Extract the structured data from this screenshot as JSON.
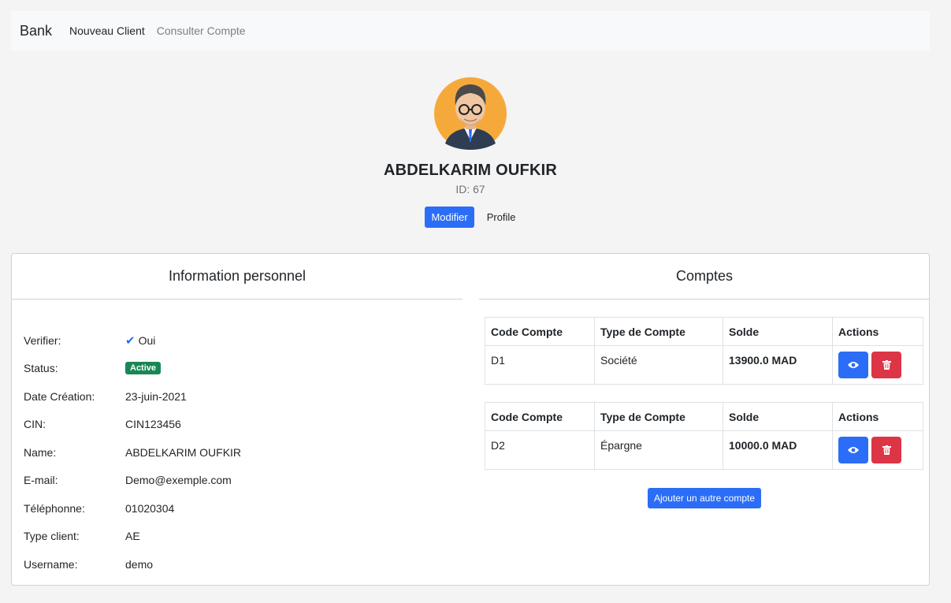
{
  "navbar": {
    "brand": "Bank",
    "links": [
      "Nouveau Client",
      "Consulter Compte"
    ]
  },
  "profile": {
    "name": "ABDELKARIM OUFKIR",
    "id": "ID: 67",
    "modify_label": "Modifier",
    "profile_label": "Profile"
  },
  "info": {
    "title": "Information personnel",
    "verified": {
      "label": "Verifier:",
      "value": "Oui"
    },
    "status": {
      "label": "Status:",
      "value": "Active"
    },
    "date": {
      "label": "Date Création:",
      "value": "23-juin-2021"
    },
    "cin": {
      "label": "CIN:",
      "value": "CIN123456"
    },
    "name": {
      "label": "Name:",
      "value": "ABDELKARIM OUFKIR"
    },
    "email": {
      "label": "E-mail:",
      "value": "Demo@exemple.com"
    },
    "phone": {
      "label": "Téléphonne:",
      "value": "01020304"
    },
    "type": {
      "label": "Type client:",
      "value": "AE"
    },
    "username": {
      "label": "Username:",
      "value": "demo"
    }
  },
  "accounts": {
    "title": "Comptes",
    "headers": [
      "Code Compte",
      "Type de Compte",
      "Solde",
      "Actions"
    ],
    "rows": [
      {
        "code": "D1",
        "type": "Société",
        "balance": "13900.0 MAD"
      },
      {
        "code": "D2",
        "type": "Épargne",
        "balance": "10000.0 MAD"
      }
    ],
    "add_label": "Ajouter un autre compte"
  },
  "colors": {
    "primary": "#2b6df6",
    "danger": "#dc3545",
    "success": "#198754"
  },
  "icons": {
    "verified": "check-icon",
    "view": "eye-icon",
    "delete": "trash-icon",
    "avatar": "avatar-illustration"
  }
}
